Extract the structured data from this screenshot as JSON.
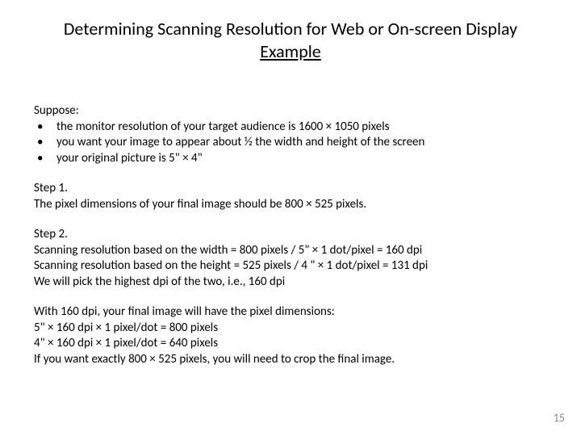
{
  "title": {
    "line1": "Determining Scanning Resolution for Web or On-screen Display",
    "line2": "Example"
  },
  "suppose": {
    "label": "Suppose:",
    "items": [
      "the monitor resolution of your target audience is 1600 × 1050 pixels",
      "you want your image to appear about ½ the width and height of the screen",
      "your original picture is 5\" × 4\""
    ]
  },
  "step1": {
    "heading": "Step 1.",
    "text": "The pixel dimensions of your final image should be 800 × 525 pixels."
  },
  "step2": {
    "heading": "Step 2.",
    "line1": "Scanning resolution based on the width = 800 pixels / 5\" × 1 dot/pixel = 160 dpi",
    "line2": "Scanning resolution based on the height = 525 pixels / 4 \" × 1 dot/pixel = 131 dpi",
    "line3": "We will pick the highest dpi of the two, i.e., 160 dpi"
  },
  "final": {
    "line1": "With 160 dpi, your final image will have  the pixel dimensions:",
    "line2": "5\" × 160 dpi × 1 pixel/dot = 800 pixels",
    "line3": "4\" × 160 dpi × 1 pixel/dot = 640 pixels",
    "line4": "If you want exactly 800 × 525 pixels, you will need to crop the final image."
  },
  "page_number": "15"
}
